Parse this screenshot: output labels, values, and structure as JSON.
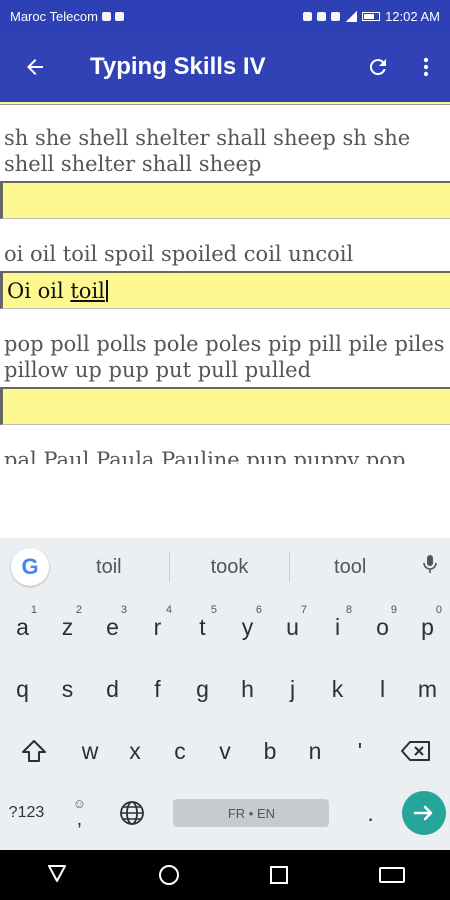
{
  "status_bar": {
    "carrier": "Maroc Telecom",
    "time": "12:02 AM"
  },
  "app_bar": {
    "title": "Typing Skills IV",
    "back_icon": "arrow-left-icon",
    "refresh_icon": "refresh-icon",
    "menu_icon": "overflow-menu-icon"
  },
  "exercises": [
    {
      "prompt": "sh she shell shelter shall sheep sh she shell shelter shall sheep",
      "value": ""
    },
    {
      "prompt": "oi oil toil spoil spoiled coil uncoil",
      "value_prefix": "Oi oil ",
      "value_last": "toil"
    },
    {
      "prompt": "pop poll polls pole poles pip pill pile piles pillow up pup put pull pulled",
      "value": ""
    },
    {
      "prompt": "pal Paul Paula Pauline pup puppy pop"
    }
  ],
  "keyboard": {
    "suggestions": [
      "toil",
      "took",
      "tool"
    ],
    "row1": [
      {
        "k": "a",
        "n": "1"
      },
      {
        "k": "z",
        "n": "2"
      },
      {
        "k": "e",
        "n": "3"
      },
      {
        "k": "r",
        "n": "4"
      },
      {
        "k": "t",
        "n": "5"
      },
      {
        "k": "y",
        "n": "6"
      },
      {
        "k": "u",
        "n": "7"
      },
      {
        "k": "i",
        "n": "8"
      },
      {
        "k": "o",
        "n": "9"
      },
      {
        "k": "p",
        "n": "0"
      }
    ],
    "row2": [
      "q",
      "s",
      "d",
      "f",
      "g",
      "h",
      "j",
      "k",
      "l",
      "m"
    ],
    "row3": [
      "w",
      "x",
      "c",
      "v",
      "b",
      "n",
      "'"
    ],
    "symbols_label": "?123",
    "comma": ",",
    "space_label": "FR • EN",
    "period": "."
  }
}
